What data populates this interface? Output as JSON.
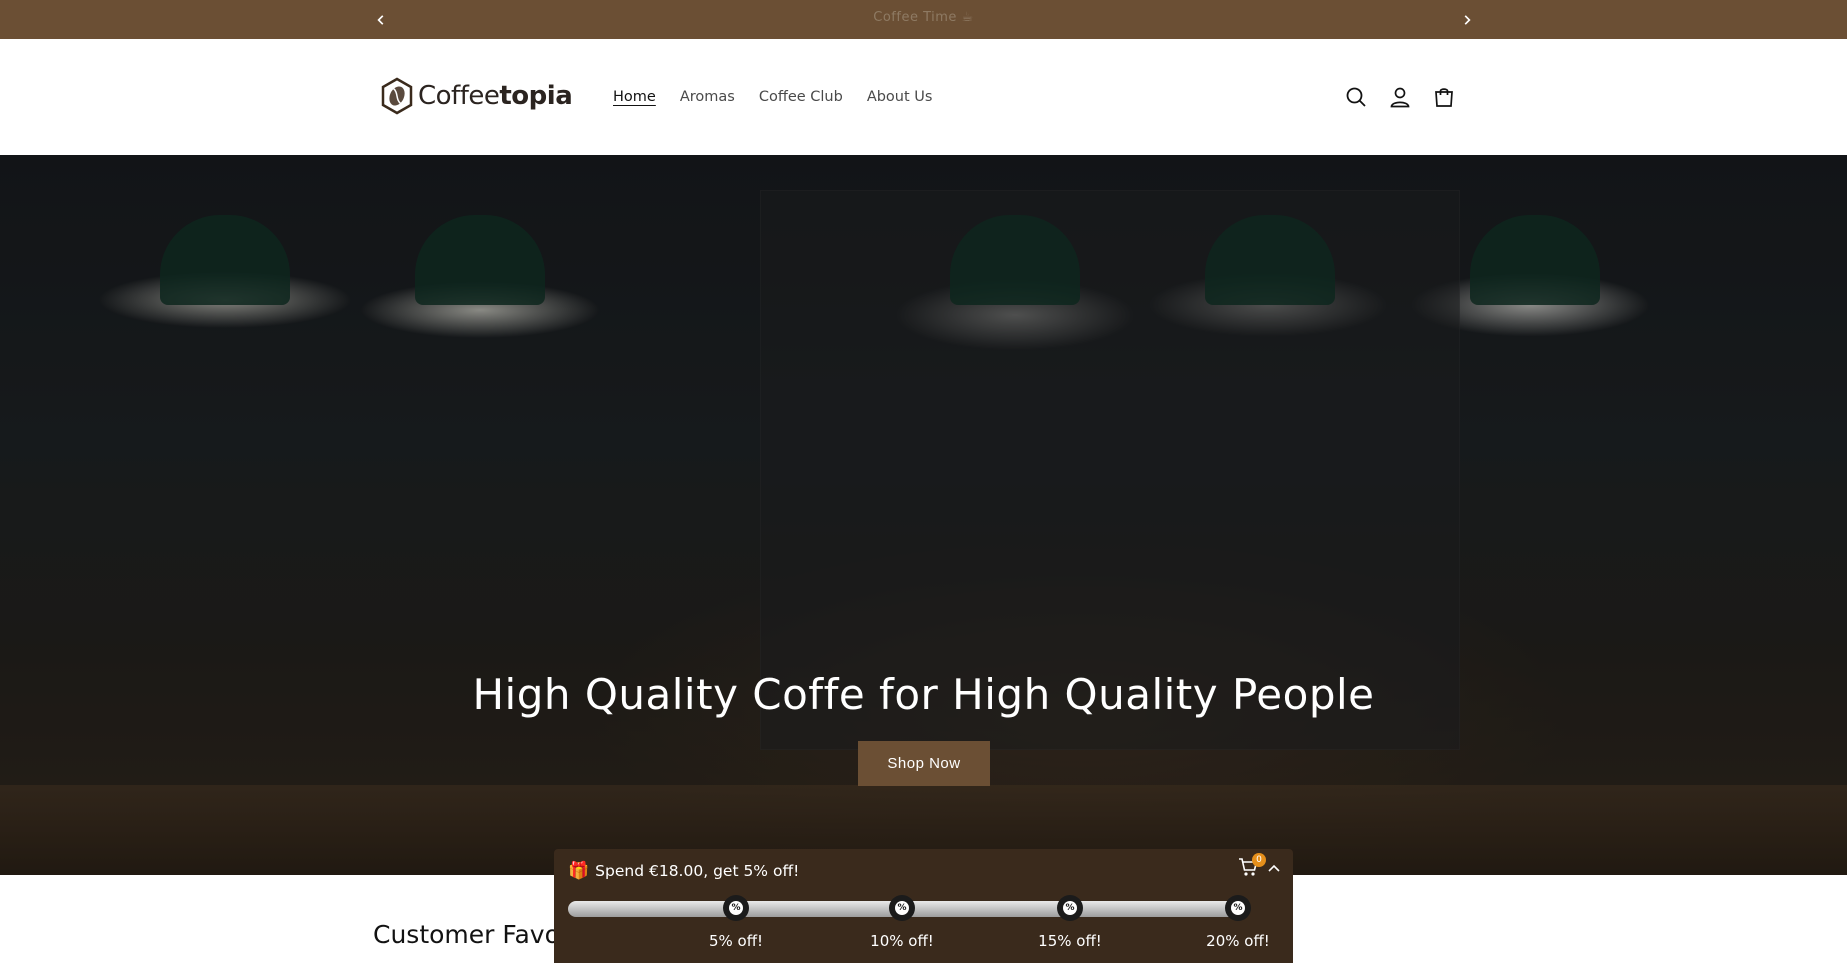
{
  "announcement": {
    "text": "Coffee Time ☕",
    "prev_icon": "chevron-left-icon",
    "next_icon": "chevron-right-icon"
  },
  "header": {
    "brand_regular": "Coffee",
    "brand_bold": "topia",
    "nav": [
      {
        "label": "Home",
        "active": true
      },
      {
        "label": "Aromas",
        "active": false
      },
      {
        "label": "Coffee Club",
        "active": false
      },
      {
        "label": "About Us",
        "active": false
      }
    ],
    "icons": [
      "search-icon",
      "account-icon",
      "cart-icon"
    ]
  },
  "hero": {
    "heading": "High Quality Coffe for High Quality People",
    "cta_label": "Shop Now"
  },
  "section": {
    "title": "Customer Favorit"
  },
  "discount_widget": {
    "gift_icon": "🎁",
    "headline": "Spend €18.00, get 5% off!",
    "cart_count": "0",
    "progress": 0,
    "milestones": [
      {
        "label": "5% off!"
      },
      {
        "label": "10% off!"
      },
      {
        "label": "15% off!"
      },
      {
        "label": "20% off!"
      }
    ]
  },
  "colors": {
    "announcement_bg": "#6b4f34",
    "button_bg": "#6b4f34",
    "widget_bg": "#3a2a1c",
    "badge": "#e58f1b"
  }
}
